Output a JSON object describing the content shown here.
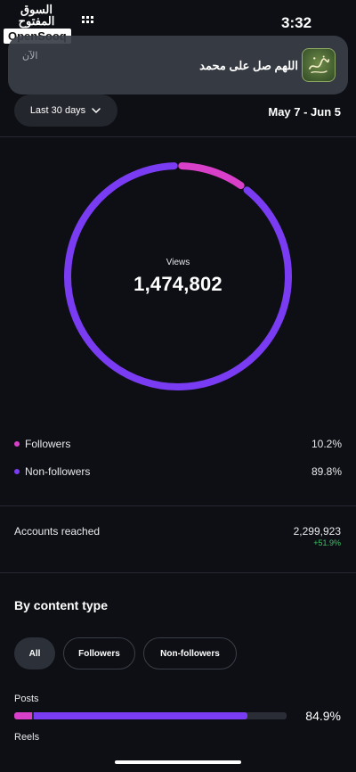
{
  "watermark": {
    "arabic": "السوق المفتوح",
    "english": "OpenSooq"
  },
  "status_bar": {
    "time": "3:32"
  },
  "notification": {
    "time_label": "الآن",
    "message": "اللهم صل على محمد",
    "icon": "calligraphy-app-icon"
  },
  "controls": {
    "date_range_button": "Last 30 days",
    "date_range": "May 7 - Jun 5"
  },
  "colors": {
    "followers": "#d940c9",
    "non_followers": "#7a3cf2",
    "positive": "#3fc16a"
  },
  "views": {
    "label": "Views",
    "total": "1,474,802",
    "followers_fraction": 0.102,
    "non_followers_fraction": 0.898
  },
  "breakdown": [
    {
      "label": "Followers",
      "value": "10.2%"
    },
    {
      "label": "Non-followers",
      "value": "89.8%"
    }
  ],
  "accounts_reached": {
    "label": "Accounts reached",
    "value": "2,299,923",
    "change": "+51.9%"
  },
  "content_type": {
    "title": "By content type",
    "filters": [
      "All",
      "Followers",
      "Non-followers"
    ],
    "selected_filter": "All",
    "posts": {
      "label": "Posts",
      "percent": "84.9%",
      "followers_share": 0.065,
      "non_followers_share": 0.784
    },
    "reels": {
      "label": "Reels"
    }
  }
}
